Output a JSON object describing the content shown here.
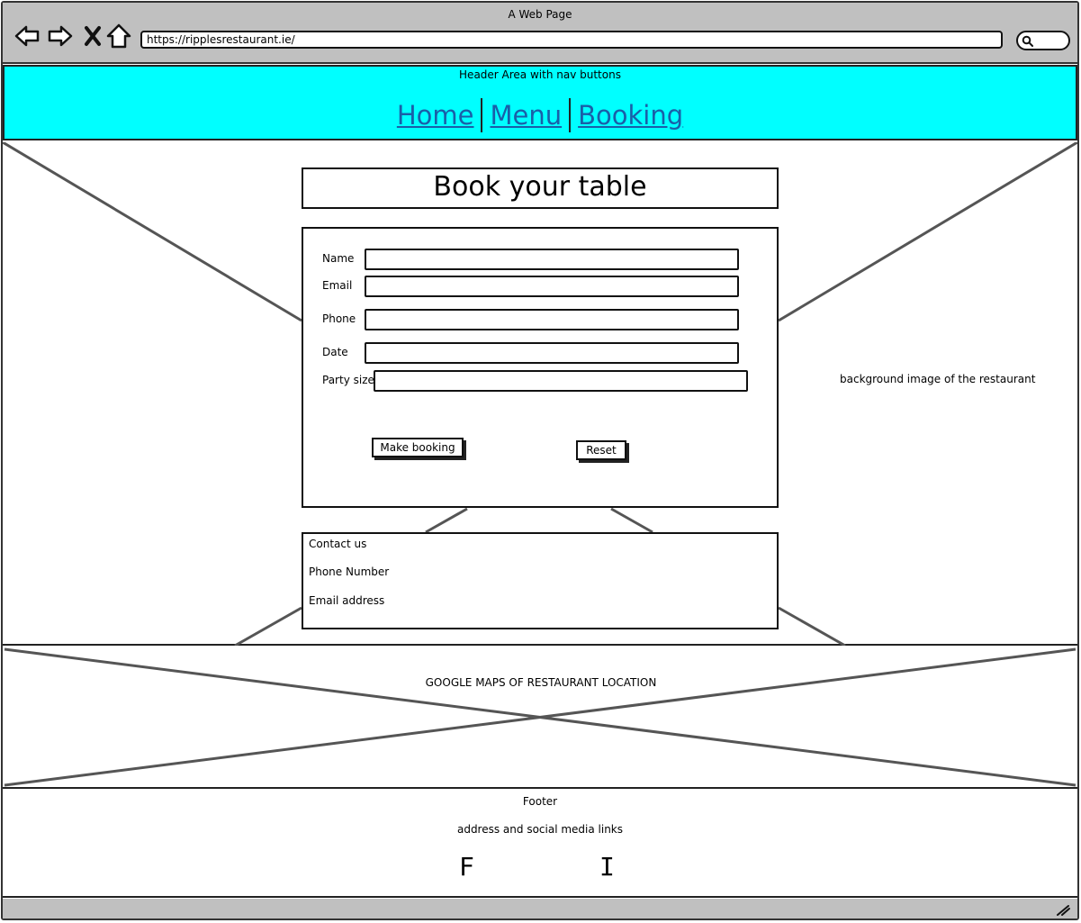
{
  "browser": {
    "window_title": "A Web Page",
    "url": "https://ripplesrestaurant.ie/",
    "icons": [
      "back-arrow-icon",
      "forward-arrow-icon",
      "close-icon",
      "home-icon",
      "search-icon"
    ]
  },
  "header": {
    "note": "Header Area with nav buttons",
    "nav": [
      "Home",
      "Menu",
      "Booking"
    ],
    "background": "#00ffff",
    "link_color": "#1a5fa8"
  },
  "hero": {
    "background_note": "background image of the restaurant",
    "title": "Book your table",
    "form": {
      "fields": [
        "Name",
        "Email",
        "Phone",
        "Date",
        "Party size"
      ],
      "submit_label": "Make booking",
      "reset_label": "Reset"
    },
    "contact": {
      "heading": "Contact us",
      "phone": "Phone Number",
      "email": "Email address"
    }
  },
  "maps": {
    "label": "GOOGLE MAPS OF RESTAURANT LOCATION"
  },
  "footer": {
    "title": "Footer",
    "subtitle": "address and social media links",
    "social": [
      "F",
      "I"
    ]
  }
}
